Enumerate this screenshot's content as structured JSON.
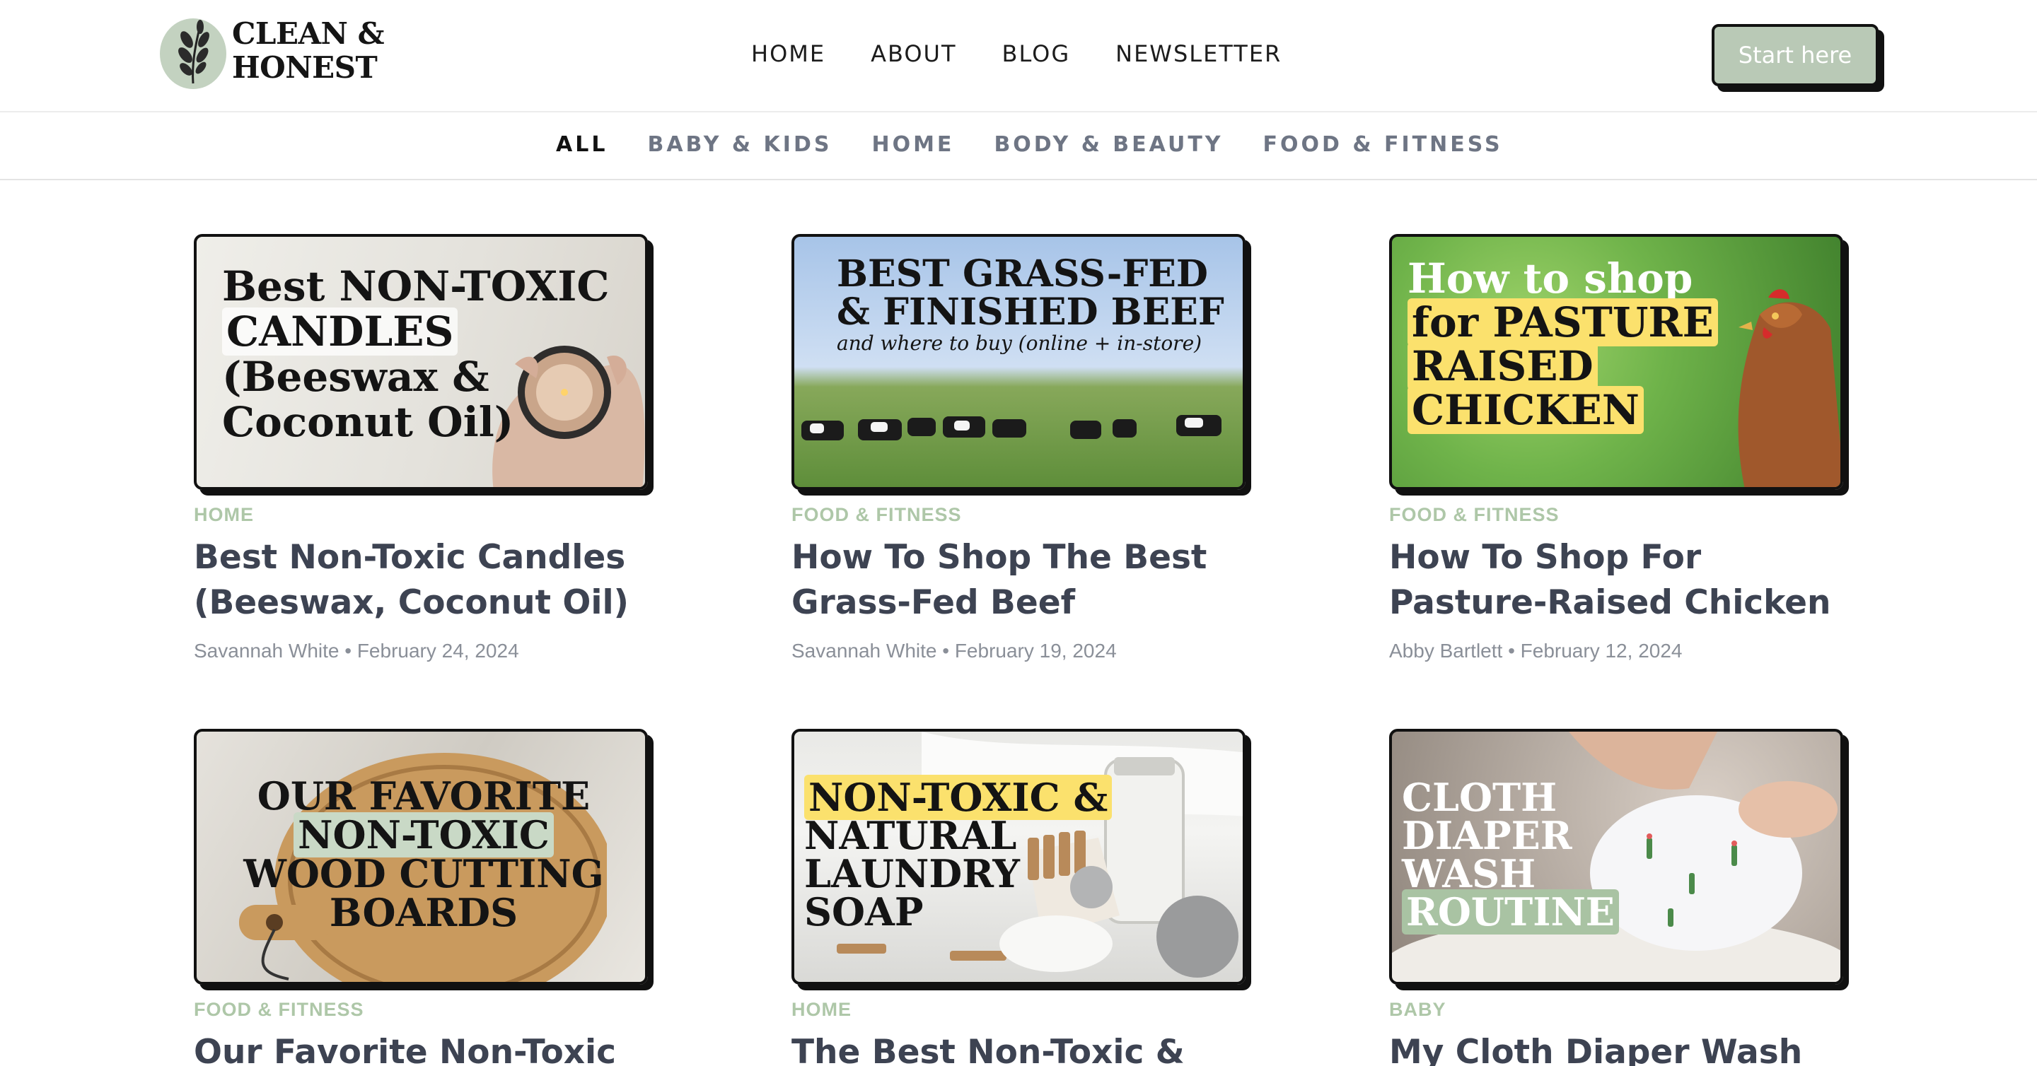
{
  "header": {
    "logo": {
      "line1": "CLEAN &",
      "line2": "HONEST"
    },
    "nav": [
      {
        "label": "HOME"
      },
      {
        "label": "ABOUT"
      },
      {
        "label": "BLOG"
      },
      {
        "label": "NEWSLETTER"
      }
    ],
    "cta_label": "Start here"
  },
  "categories": [
    {
      "label": "ALL",
      "active": true
    },
    {
      "label": "BABY & KIDS",
      "active": false
    },
    {
      "label": "HOME",
      "active": false
    },
    {
      "label": "BODY & BEAUTY",
      "active": false
    },
    {
      "label": "FOOD & FITNESS",
      "active": false
    }
  ],
  "colors": {
    "accent_green": "#b9c9b6",
    "category_green": "#aec7a8",
    "highlight_yellow": "#fbe16d",
    "title_text": "#3d4352"
  },
  "posts": [
    {
      "category": "HOME",
      "title": "Best Non-Toxic Candles (Beeswax, Coconut Oil)",
      "meta": "Savannah White • February 24, 2024",
      "thumb": {
        "lines": [
          "Best NON-TOXIC",
          "CANDLES",
          "(Beeswax &",
          "Coconut Oil)"
        ]
      }
    },
    {
      "category": "FOOD & FITNESS",
      "title": "How To Shop The Best Grass-Fed Beef",
      "meta": "Savannah White • February 19, 2024",
      "thumb": {
        "lines": [
          "BEST GRASS-FED",
          "& FINISHED BEEF"
        ],
        "subtitle": "and where to buy (online + in-store)"
      }
    },
    {
      "category": "FOOD & FITNESS",
      "title": "How To Shop For Pasture-Raised Chicken",
      "meta": "Abby Bartlett • February 12, 2024",
      "thumb": {
        "lines": [
          "How to shop",
          "for PASTURE",
          "RAISED",
          "CHICKEN"
        ]
      }
    },
    {
      "category": "FOOD & FITNESS",
      "title": "Our Favorite Non-Toxic",
      "meta": "",
      "thumb": {
        "lines": [
          "OUR FAVORITE",
          "NON-TOXIC",
          "WOOD CUTTING",
          "BOARDS"
        ]
      }
    },
    {
      "category": "HOME",
      "title": "The Best Non-Toxic &",
      "meta": "",
      "thumb": {
        "lines": [
          "NON-TOXIC &",
          "NATURAL",
          "LAUNDRY",
          "SOAP"
        ]
      }
    },
    {
      "category": "BABY",
      "title": "My Cloth Diaper Wash",
      "meta": "",
      "thumb": {
        "lines": [
          "CLOTH",
          "DIAPER",
          "WASH",
          "ROUTINE"
        ]
      }
    }
  ]
}
